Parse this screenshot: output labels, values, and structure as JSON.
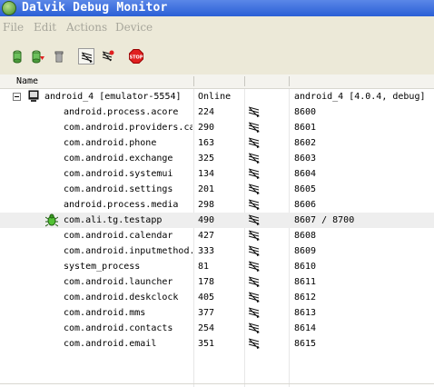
{
  "window": {
    "title": "Dalvik Debug Monitor",
    "app_icon": "ddms-android-icon"
  },
  "menu": [
    "File",
    "Edit",
    "Actions",
    "Device"
  ],
  "toolbar": {
    "buttons": [
      {
        "name": "update-heap-button",
        "icon": "heap-icon"
      },
      {
        "name": "dump-hprof-button",
        "icon": "dump-icon"
      },
      {
        "name": "cause-gc-button",
        "icon": "trash-icon"
      },
      {
        "name": "update-threads-button",
        "icon": "threads-icon",
        "pressed": true
      },
      {
        "name": "method-profiling-button",
        "icon": "profiling-icon"
      },
      {
        "name": "stop-process-button",
        "icon": "stop-icon",
        "text": "STOP"
      }
    ]
  },
  "table": {
    "header": {
      "name": "Name"
    },
    "device": {
      "name": "android_4 [emulator-5554]",
      "status": "Online",
      "info": "android_4 [4.0.4, debug]"
    },
    "processes": [
      {
        "name": "android.process.acore",
        "pid": "224",
        "port": "8600"
      },
      {
        "name": "com.android.providers.ca",
        "pid": "290",
        "port": "8601"
      },
      {
        "name": "com.android.phone",
        "pid": "163",
        "port": "8602"
      },
      {
        "name": "com.android.exchange",
        "pid": "325",
        "port": "8603"
      },
      {
        "name": "com.android.systemui",
        "pid": "134",
        "port": "8604"
      },
      {
        "name": "com.android.settings",
        "pid": "201",
        "port": "8605"
      },
      {
        "name": "android.process.media",
        "pid": "298",
        "port": "8606"
      },
      {
        "name": "com.ali.tg.testapp",
        "pid": "490",
        "port": "8607 / 8700",
        "debug": true,
        "selected": true
      },
      {
        "name": "com.android.calendar",
        "pid": "427",
        "port": "8608"
      },
      {
        "name": "com.android.inputmethod.",
        "pid": "333",
        "port": "8609"
      },
      {
        "name": "system_process",
        "pid": "81",
        "port": "8610"
      },
      {
        "name": "com.android.launcher",
        "pid": "178",
        "port": "8611"
      },
      {
        "name": "com.android.deskclock",
        "pid": "405",
        "port": "8612"
      },
      {
        "name": "com.android.mms",
        "pid": "377",
        "port": "8613"
      },
      {
        "name": "com.android.contacts",
        "pid": "254",
        "port": "8614"
      },
      {
        "name": "com.android.email",
        "pid": "351",
        "port": "8615"
      }
    ]
  }
}
